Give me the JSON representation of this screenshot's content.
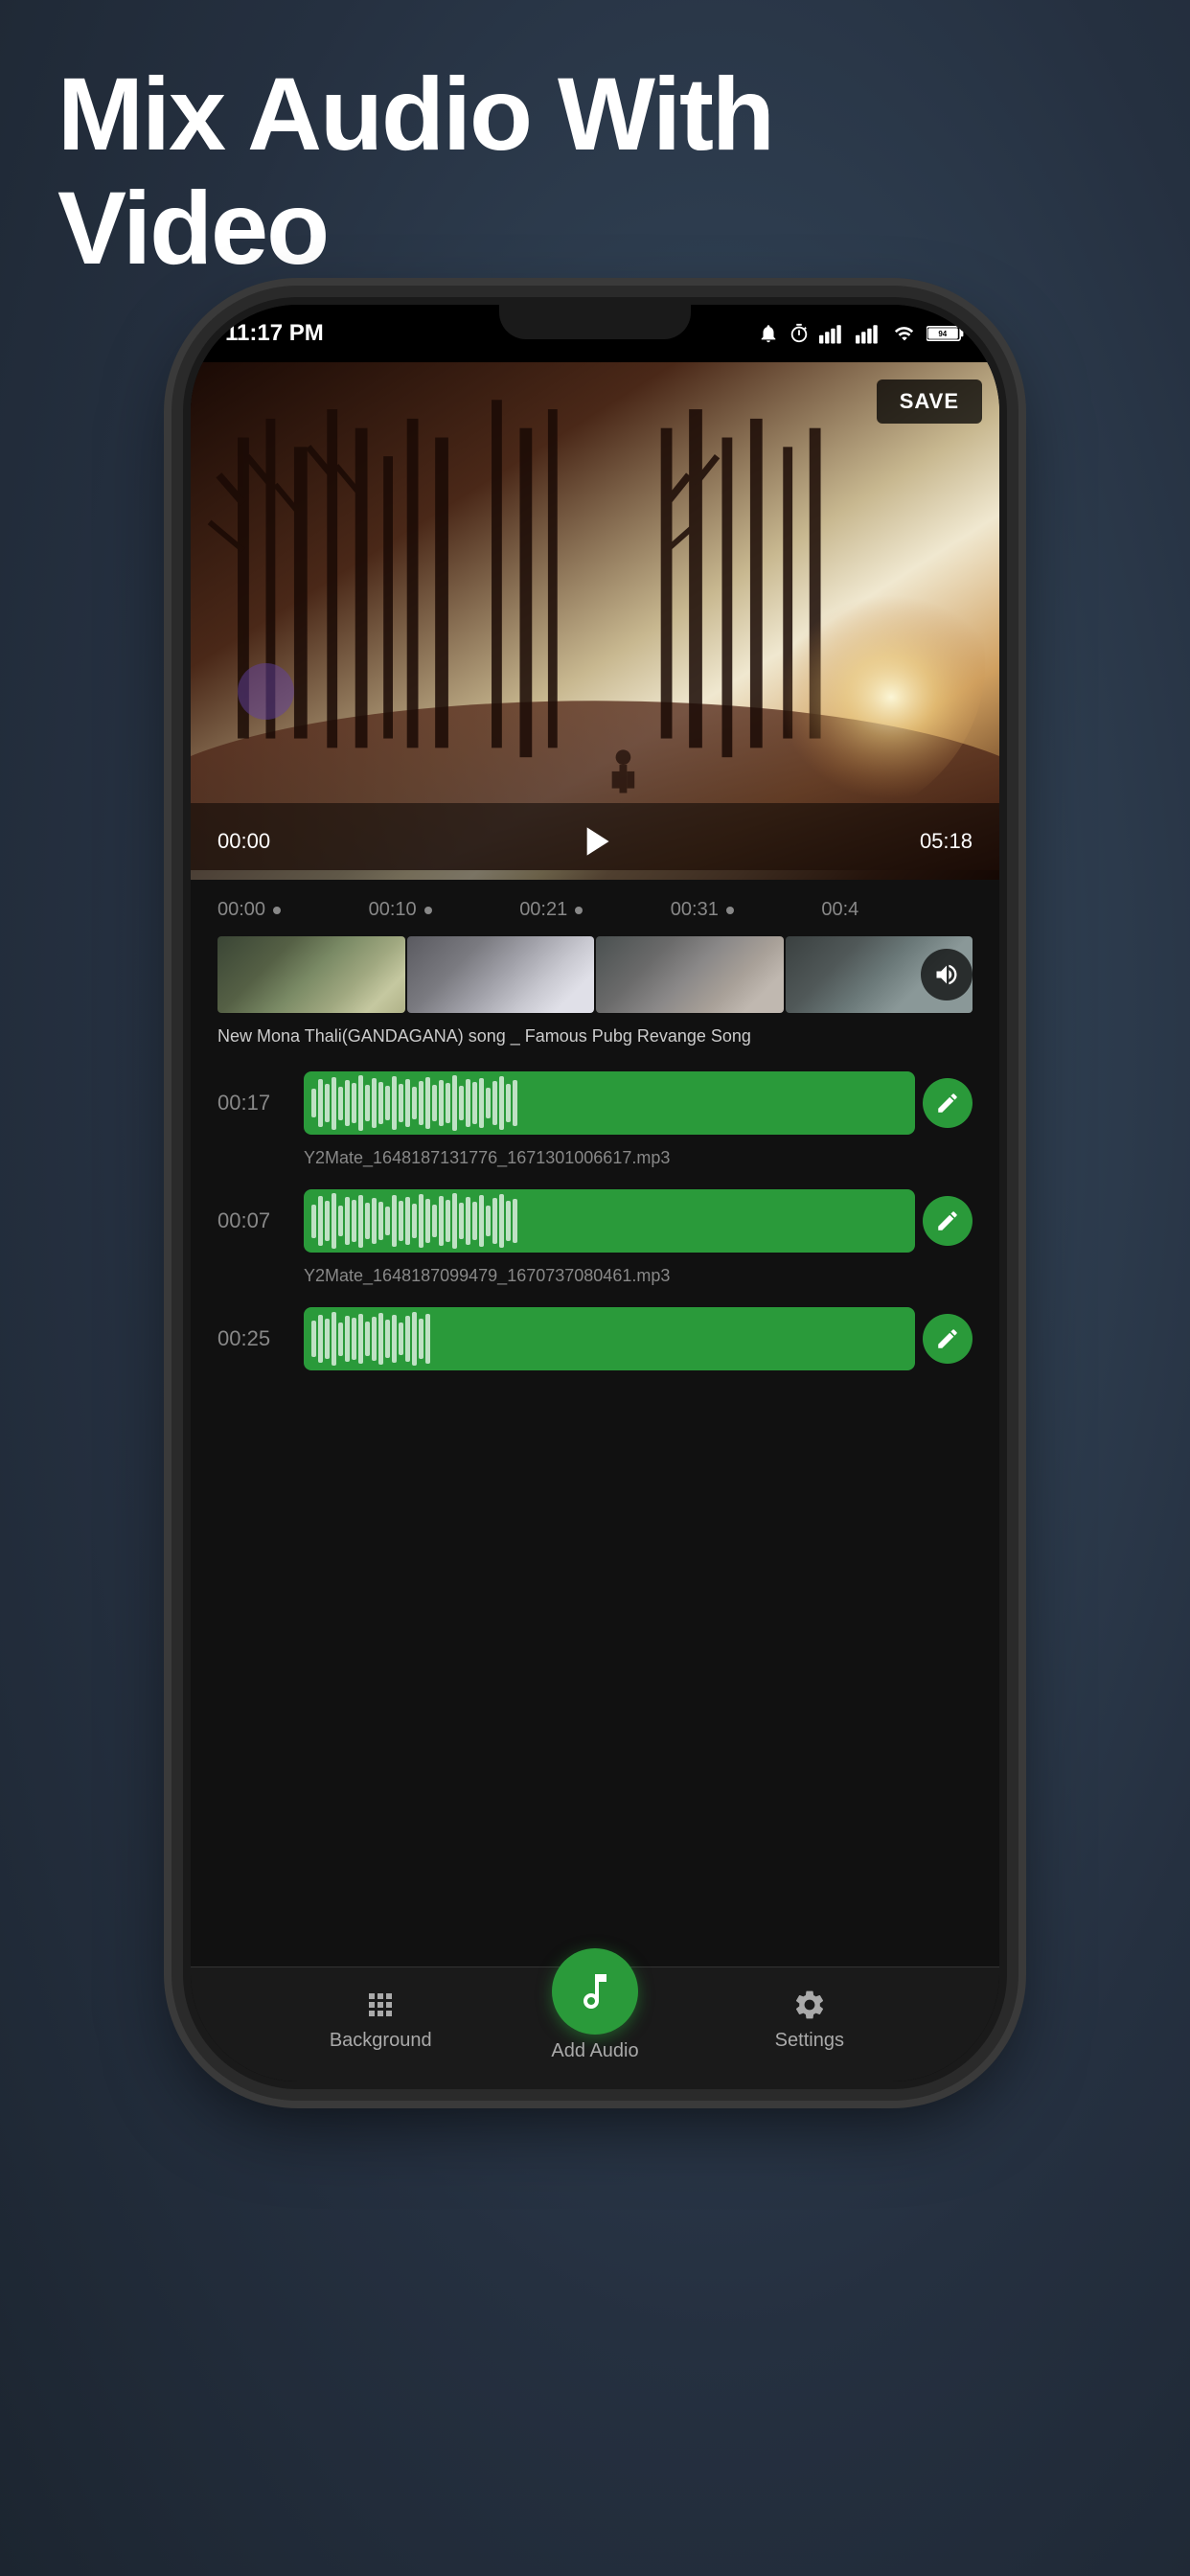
{
  "page": {
    "hero_title": "Mix Audio With\nVideo",
    "background_color": "#2d3a4a"
  },
  "status_bar": {
    "time": "11:17 PM",
    "battery": "94",
    "icons": [
      "alarm",
      "timer",
      "signal1",
      "signal2",
      "wifi",
      "battery"
    ]
  },
  "video_player": {
    "save_label": "SAVE",
    "time_current": "00:00",
    "time_total": "05:18"
  },
  "timeline": {
    "marks": [
      "00:00",
      "00:10",
      "00:21",
      "00:31",
      "00:4"
    ]
  },
  "video_track": {
    "title": "New  Mona Thali(GANDAGANA) song _ Famous Pubg Revange Song"
  },
  "audio_tracks": [
    {
      "time": "00:17",
      "filename": "Y2Mate_1648187131776_1671301006617.mp3"
    },
    {
      "time": "00:07",
      "filename": "Y2Mate_1648187099479_1670737080461.mp3"
    },
    {
      "time": "00:25",
      "filename": ""
    }
  ],
  "bottom_nav": {
    "items": [
      {
        "label": "Background",
        "icon": "grid-icon"
      },
      {
        "label": "Add Audio",
        "icon": "music-icon"
      },
      {
        "label": "Settings",
        "icon": "gear-icon"
      }
    ]
  }
}
